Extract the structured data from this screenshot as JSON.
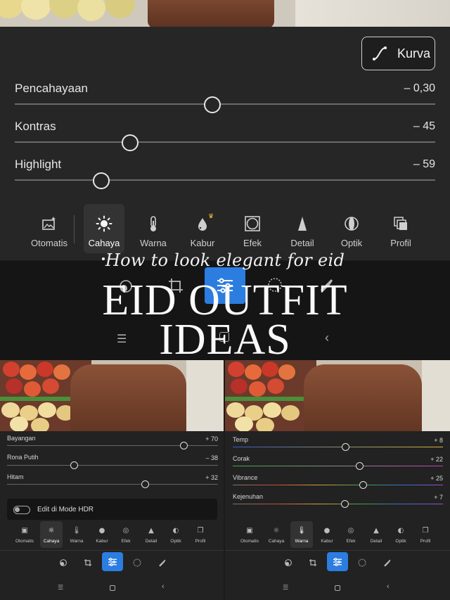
{
  "curve_button": {
    "label": "Kurva"
  },
  "sliders": [
    {
      "label": "Pencahayaan",
      "value_text": "– 0,30",
      "value": -0.3,
      "min": -5,
      "max": 5
    },
    {
      "label": "Kontras",
      "value_text": "– 45",
      "value": -45,
      "min": -100,
      "max": 100
    },
    {
      "label": "Highlight",
      "value_text": "– 59",
      "value": -59,
      "min": -100,
      "max": 100
    }
  ],
  "tools": [
    "Otomatis",
    "Cahaya",
    "Warna",
    "Kabur",
    "Efek",
    "Detail",
    "Optik",
    "Profil"
  ],
  "active_tool": "Cahaya",
  "overlay": {
    "subtitle": "How to look elegant for eid",
    "title_line1": "EID OUTFIT",
    "title_line2": "IDEAS"
  },
  "left_panel": {
    "sliders": [
      {
        "label": "Bayangan",
        "value_text": "+ 70",
        "value": 70
      },
      {
        "label": "Rona Putih",
        "value_text": "– 38",
        "value": -38
      },
      {
        "label": "Hitam",
        "value_text": "+ 32",
        "value": 32
      }
    ],
    "hdr_toggle": {
      "label": "Edit di Mode HDR",
      "on": false
    },
    "active_tool": "Cahaya"
  },
  "right_panel": {
    "sliders": [
      {
        "label": "Temp",
        "value_text": "+ 8",
        "value": 8
      },
      {
        "label": "Corak",
        "value_text": "+ 22",
        "value": 22
      },
      {
        "label": "Vibrance",
        "value_text": "+ 25",
        "value": 25
      },
      {
        "label": "Kejenuhan",
        "value_text": "+ 7",
        "value": 7
      }
    ],
    "active_tool": "Warna"
  },
  "colors": {
    "accent_blue": "#2b7de0",
    "crown_gold": "#f3c23a",
    "panel_bg": "#262626"
  },
  "icons": {
    "curve": "curve-icon",
    "auto": "auto-enhance-icon",
    "light": "sun-icon",
    "color": "thermometer-icon",
    "blur": "droplet-icon",
    "effects": "vignette-icon",
    "detail": "triangle-icon",
    "optics": "lens-icon",
    "profile": "stacked-squares-icon",
    "menu": "menu-icon",
    "home": "home-icon",
    "back": "back-icon"
  }
}
